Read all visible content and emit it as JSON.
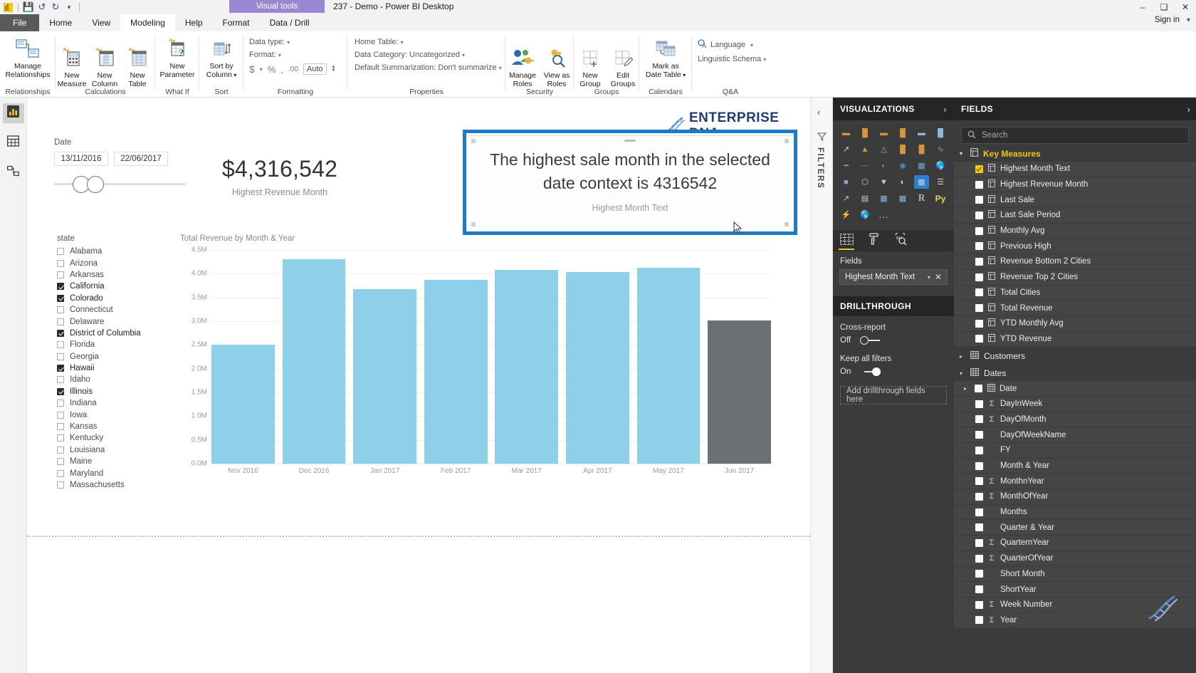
{
  "titlebar": {
    "quick_access": [
      "save-icon",
      "undo-icon",
      "redo-icon",
      "customize-icon"
    ],
    "contextual_tab_group": "Visual tools",
    "document_title": "237 - Demo - Power BI Desktop",
    "window_controls": [
      "minimize",
      "restore",
      "close"
    ],
    "sign_in": "Sign in"
  },
  "tabs": [
    {
      "label": "File",
      "state": "file"
    },
    {
      "label": "Home",
      "state": "normal"
    },
    {
      "label": "View",
      "state": "normal"
    },
    {
      "label": "Modeling",
      "state": "active"
    },
    {
      "label": "Help",
      "state": "normal"
    },
    {
      "label": "Format",
      "state": "contextual"
    },
    {
      "label": "Data / Drill",
      "state": "contextual"
    }
  ],
  "ribbon": {
    "groups": [
      {
        "title": "Relationships",
        "buttons": [
          {
            "label_line1": "Manage",
            "label_line2": "Relationships",
            "icon": "manage-relationships-icon"
          }
        ]
      },
      {
        "title": "Calculations",
        "buttons": [
          {
            "label_line1": "New",
            "label_line2": "Measure",
            "icon": "new-measure-icon"
          },
          {
            "label_line1": "New",
            "label_line2": "Column",
            "icon": "new-column-icon"
          },
          {
            "label_line1": "New",
            "label_line2": "Table",
            "icon": "new-table-icon"
          }
        ]
      },
      {
        "title": "What If",
        "buttons": [
          {
            "label_line1": "New",
            "label_line2": "Parameter",
            "icon": "new-parameter-icon"
          }
        ]
      },
      {
        "title": "Sort",
        "buttons": [
          {
            "label_line1": "Sort by",
            "label_line2": "Column",
            "icon": "sort-by-column-icon",
            "has_caret": true
          }
        ]
      },
      {
        "title": "Formatting",
        "rows": [
          "Data type:",
          "Format:"
        ],
        "currency_symbol": "$",
        "percent_symbol": "%",
        "comma_symbol": ",",
        "decimal_symbol": ".00",
        "auto_value": "Auto"
      },
      {
        "title": "Properties",
        "rows": [
          "Home Table:",
          "Data Category: Uncategorized",
          "Default Summarization: Don't summarize"
        ]
      },
      {
        "title": "Security",
        "buttons": [
          {
            "label_line1": "Manage",
            "label_line2": "Roles",
            "icon": "manage-roles-icon"
          },
          {
            "label_line1": "View as",
            "label_line2": "Roles",
            "icon": "view-as-roles-icon"
          }
        ]
      },
      {
        "title": "Groups",
        "buttons": [
          {
            "label_line1": "New",
            "label_line2": "Group",
            "icon": "new-group-icon"
          },
          {
            "label_line1": "Edit",
            "label_line2": "Groups",
            "icon": "edit-groups-icon"
          }
        ]
      },
      {
        "title": "Calendars",
        "buttons": [
          {
            "label_line1": "Mark as",
            "label_line2": "Date Table",
            "icon": "mark-as-date-table-icon",
            "has_caret": true
          }
        ]
      },
      {
        "title": "Q&A",
        "rows": [
          "Language",
          "Linguistic Schema"
        ]
      }
    ]
  },
  "leftnav": {
    "items": [
      {
        "name": "report-view",
        "icon": "report-view-icon",
        "active": true
      },
      {
        "name": "data-view",
        "icon": "data-view-icon",
        "active": false
      },
      {
        "name": "model-view",
        "icon": "model-view-icon",
        "active": false
      }
    ]
  },
  "canvas": {
    "watermark": "ENTERPRISE DNA",
    "slicer": {
      "title": "Date",
      "start_date": "13/11/2016",
      "end_date": "22/06/2017"
    },
    "state_slicer": {
      "title": "state",
      "items": [
        {
          "label": "Alabama",
          "checked": false
        },
        {
          "label": "Arizona",
          "checked": false
        },
        {
          "label": "Arkansas",
          "checked": false
        },
        {
          "label": "California",
          "checked": true
        },
        {
          "label": "Colorado",
          "checked": true
        },
        {
          "label": "Connecticut",
          "checked": false
        },
        {
          "label": "Delaware",
          "checked": false
        },
        {
          "label": "District of Columbia",
          "checked": true
        },
        {
          "label": "Florida",
          "checked": false
        },
        {
          "label": "Georgia",
          "checked": false
        },
        {
          "label": "Hawaii",
          "checked": true
        },
        {
          "label": "Idaho",
          "checked": false
        },
        {
          "label": "Illinois",
          "checked": true
        },
        {
          "label": "Indiana",
          "checked": false
        },
        {
          "label": "Iowa",
          "checked": false
        },
        {
          "label": "Kansas",
          "checked": false
        },
        {
          "label": "Kentucky",
          "checked": false
        },
        {
          "label": "Louisiana",
          "checked": false
        },
        {
          "label": "Maine",
          "checked": false
        },
        {
          "label": "Maryland",
          "checked": false
        },
        {
          "label": "Massachusetts",
          "checked": false
        }
      ]
    },
    "card": {
      "value": "$4,316,542",
      "label": "Highest Revenue Month"
    },
    "textvisual": {
      "text": "The highest sale month in the selected date context is 4316542",
      "caption": "Highest Month Text",
      "selected": true,
      "selection_color": "#1f7ac4"
    }
  },
  "chart_data": {
    "type": "bar",
    "title": "Total Revenue by Month & Year",
    "xlabel": "",
    "ylabel": "",
    "categories": [
      "Nov 2016",
      "Dec 2016",
      "Jan 2017",
      "Feb 2017",
      "Mar 2017",
      "Apr 2017",
      "May 2017",
      "Jun 2017"
    ],
    "values": [
      2500000,
      4310000,
      3680000,
      3870000,
      4080000,
      4030000,
      4120000,
      3020000
    ],
    "ylim": [
      0,
      4500000
    ],
    "ytick_labels": [
      "0.0M",
      "0.5M",
      "1.0M",
      "1.5M",
      "2.0M",
      "2.5M",
      "3.0M",
      "3.5M",
      "4.0M",
      "4.5M"
    ],
    "ytick_values": [
      0,
      500000,
      1000000,
      1500000,
      2000000,
      2500000,
      3000000,
      3500000,
      4000000,
      4500000
    ],
    "grid": true,
    "legend": "none",
    "bar_color": "#8ed0ea",
    "highlight_color": "#6b7072",
    "highlighted_index": 7
  },
  "filters_rail": {
    "collapse_icon": "chevron-left-icon",
    "funnel_icon": "filter-funnel-icon",
    "label": "FILTERS"
  },
  "visualizations": {
    "header": "VISUALIZATIONS",
    "expand_icon": "chevron-right-icon",
    "icons": [
      "stacked-bar-chart-icon",
      "stacked-column-chart-icon",
      "clustered-bar-chart-icon",
      "clustered-column-chart-icon",
      "hundred-percent-stacked-bar-icon",
      "hundred-percent-stacked-column-icon",
      "line-chart-icon",
      "area-chart-icon",
      "stacked-area-chart-icon",
      "line-stacked-column-icon",
      "line-clustered-column-icon",
      "ribbon-chart-icon",
      "waterfall-chart-icon",
      "scatter-chart-icon",
      "pie-chart-icon",
      "donut-chart-icon",
      "treemap-icon",
      "map-icon",
      "filled-map-icon",
      "shape-map-icon",
      "funnel-icon",
      "gauge-icon",
      "card-icon",
      "multi-row-card-icon",
      "kpi-icon",
      "slicer-icon",
      "table-icon",
      "matrix-icon",
      "r-script-visual-icon",
      "python-visual-icon",
      "key-influencers-icon",
      "arcgis-map-icon",
      "more-visuals-icon"
    ],
    "selected_icon": "card-icon",
    "selected_color": "#2c7fd4",
    "r_label": "R",
    "py_label": "Py",
    "more_label": "...",
    "tabs": [
      {
        "name": "fields-tab",
        "icon": "fields-table-icon",
        "active": true
      },
      {
        "name": "format-tab",
        "icon": "paint-roller-icon",
        "active": false
      },
      {
        "name": "analytics-tab",
        "icon": "analytics-magnifier-icon",
        "active": false
      }
    ],
    "fields_label": "Fields",
    "field_well": {
      "value": "Highest Month Text",
      "caret": "chevron-down-icon",
      "remove": "remove-icon"
    },
    "drillthrough": {
      "header": "DRILLTHROUGH",
      "cross_report_label": "Cross-report",
      "cross_report_state": "Off",
      "keep_all_filters_label": "Keep all filters",
      "keep_all_filters_state": "On",
      "dropzone_placeholder": "Add drillthrough fields here"
    }
  },
  "fields": {
    "header": "FIELDS",
    "expand_icon": "chevron-right-icon",
    "search_placeholder": "Search",
    "search_icon": "search-icon",
    "tables": [
      {
        "name": "Key Measures",
        "expanded": true,
        "highlighted": true,
        "icon": "measures-table-icon",
        "items": [
          {
            "label": "Highest Month Text",
            "checked": true,
            "type": "measure"
          },
          {
            "label": "Highest Revenue Month",
            "checked": false,
            "type": "measure"
          },
          {
            "label": "Last Sale",
            "checked": false,
            "type": "measure"
          },
          {
            "label": "Last Sale Period",
            "checked": false,
            "type": "measure"
          },
          {
            "label": "Monthly Avg",
            "checked": false,
            "type": "measure"
          },
          {
            "label": "Previous High",
            "checked": false,
            "type": "measure"
          },
          {
            "label": "Revenue Bottom 2 Cities",
            "checked": false,
            "type": "measure"
          },
          {
            "label": "Revenue Top 2 Cities",
            "checked": false,
            "type": "measure"
          },
          {
            "label": "Total Cities",
            "checked": false,
            "type": "measure"
          },
          {
            "label": "Total Revenue",
            "checked": false,
            "type": "measure"
          },
          {
            "label": "YTD Monthly Avg",
            "checked": false,
            "type": "measure"
          },
          {
            "label": "YTD Revenue",
            "checked": false,
            "type": "measure"
          }
        ]
      },
      {
        "name": "Customers",
        "expanded": false,
        "highlighted": false,
        "icon": "table-icon",
        "items": []
      },
      {
        "name": "Dates",
        "expanded": true,
        "highlighted": false,
        "icon": "table-icon",
        "items": [
          {
            "label": "Date",
            "checked": false,
            "type": "hierarchy"
          },
          {
            "label": "DayInWeek",
            "checked": false,
            "type": "sum"
          },
          {
            "label": "DayOfMonth",
            "checked": false,
            "type": "sum"
          },
          {
            "label": "DayOfWeekName",
            "checked": false,
            "type": "text"
          },
          {
            "label": "FY",
            "checked": false,
            "type": "text"
          },
          {
            "label": "Month & Year",
            "checked": false,
            "type": "text"
          },
          {
            "label": "MonthnYear",
            "checked": false,
            "type": "sum"
          },
          {
            "label": "MonthOfYear",
            "checked": false,
            "type": "sum"
          },
          {
            "label": "Months",
            "checked": false,
            "type": "text"
          },
          {
            "label": "Quarter & Year",
            "checked": false,
            "type": "text"
          },
          {
            "label": "QuarternYear",
            "checked": false,
            "type": "sum"
          },
          {
            "label": "QuarterOfYear",
            "checked": false,
            "type": "sum"
          },
          {
            "label": "Short Month",
            "checked": false,
            "type": "text"
          },
          {
            "label": "ShortYear",
            "checked": false,
            "type": "text"
          },
          {
            "label": "Week Number",
            "checked": false,
            "type": "sum"
          },
          {
            "label": "Year",
            "checked": false,
            "type": "sum"
          }
        ]
      }
    ]
  }
}
